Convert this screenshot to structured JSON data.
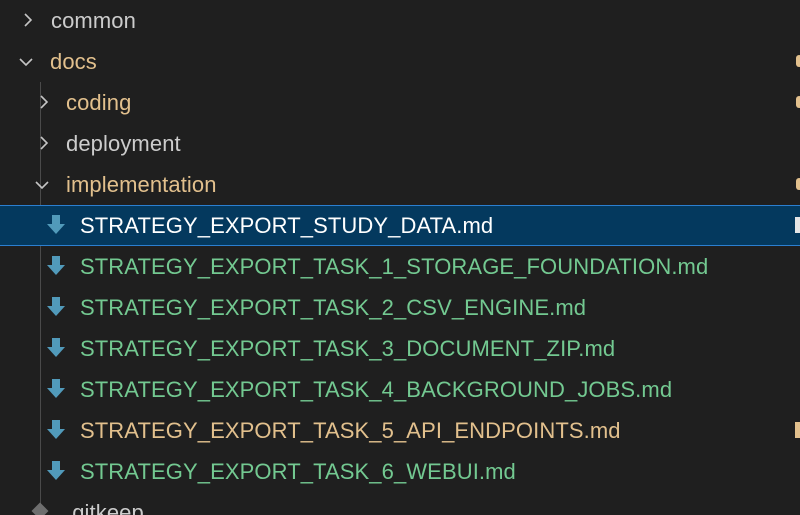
{
  "colors": {
    "background": "#1f1f1f",
    "selection_bg": "#04395e",
    "selection_border": "#2b7fd0",
    "folder_default": "#cccccc",
    "folder_modified": "#e2c08d",
    "file_untracked": "#73c991",
    "file_modified": "#e2c08d",
    "file_selected": "#ffffff",
    "markdown_icon": "#519aba",
    "chevron": "#c5c5c5"
  },
  "explorer": {
    "folders": {
      "common": "common",
      "docs": "docs",
      "coding": "coding",
      "deployment": "deployment",
      "implementation": "implementation"
    },
    "files": [
      {
        "name": "STRATEGY_EXPORT_STUDY_DATA.md",
        "icon": "markdown-download-icon",
        "status": "selected"
      },
      {
        "name": "STRATEGY_EXPORT_TASK_1_STORAGE_FOUNDATION.md",
        "icon": "markdown-download-icon",
        "status": "untracked"
      },
      {
        "name": "STRATEGY_EXPORT_TASK_2_CSV_ENGINE.md",
        "icon": "markdown-download-icon",
        "status": "untracked"
      },
      {
        "name": "STRATEGY_EXPORT_TASK_3_DOCUMENT_ZIP.md",
        "icon": "markdown-download-icon",
        "status": "untracked"
      },
      {
        "name": "STRATEGY_EXPORT_TASK_4_BACKGROUND_JOBS.md",
        "icon": "markdown-download-icon",
        "status": "untracked"
      },
      {
        "name": "STRATEGY_EXPORT_TASK_5_API_ENDPOINTS.md",
        "icon": "markdown-download-icon",
        "status": "modified"
      },
      {
        "name": "STRATEGY_EXPORT_TASK_6_WEBUI.md",
        "icon": "markdown-download-icon",
        "status": "untracked"
      }
    ],
    "gitkeep": ".gitkeep"
  }
}
